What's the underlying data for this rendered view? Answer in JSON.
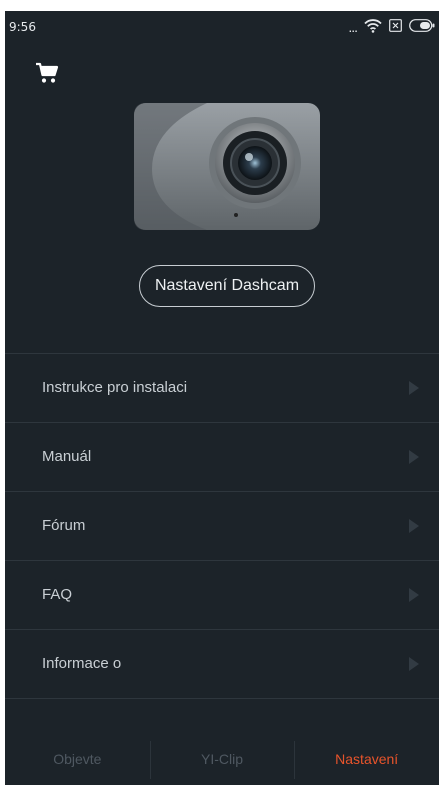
{
  "status_bar": {
    "time": "9:56",
    "dots": "...",
    "icons": [
      "wifi-icon",
      "sim-icon",
      "battery-icon"
    ]
  },
  "header": {
    "cart_icon": "cart-icon"
  },
  "hero": {
    "dashcam_button_label": "Nastavení Dashcam"
  },
  "menu": {
    "items": [
      {
        "label": "Instrukce pro instalaci"
      },
      {
        "label": "Manuál"
      },
      {
        "label": "Fórum"
      },
      {
        "label": "FAQ"
      },
      {
        "label": "Informace o"
      }
    ]
  },
  "bottom_nav": {
    "tabs": [
      {
        "label": "Objevte"
      },
      {
        "label": "YI-Clip"
      },
      {
        "label": "Nastavení"
      }
    ],
    "active_color": "#e8542b",
    "inactive_color": "#4f5861"
  },
  "colors": {
    "background": "#1c2329",
    "divider": "#2e363d"
  }
}
